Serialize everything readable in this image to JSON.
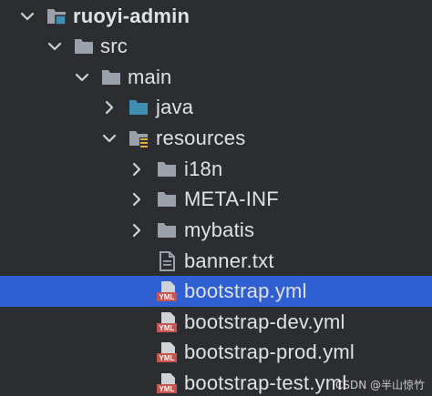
{
  "colors": {
    "background": "#2b2d30",
    "selection": "#2f5fd1",
    "text": "#dfe1e5",
    "folder": "#9aa1ab",
    "source_folder": "#3f8fb3",
    "resources_badge": "#e0b039",
    "yml_badge": "#c75450"
  },
  "tree": {
    "project": {
      "label": "ruoyi-admin",
      "icon": "module-folder-icon",
      "state": "expanded"
    },
    "src": {
      "label": "src",
      "icon": "folder-icon",
      "state": "expanded"
    },
    "main": {
      "label": "main",
      "icon": "folder-icon",
      "state": "expanded"
    },
    "java": {
      "label": "java",
      "icon": "source-folder-icon",
      "state": "collapsed"
    },
    "resources": {
      "label": "resources",
      "icon": "resources-folder-icon",
      "state": "expanded"
    },
    "i18n": {
      "label": "i18n",
      "icon": "folder-icon",
      "state": "collapsed"
    },
    "meta_inf": {
      "label": "META-INF",
      "icon": "folder-icon",
      "state": "collapsed"
    },
    "mybatis": {
      "label": "mybatis",
      "icon": "folder-icon",
      "state": "collapsed"
    },
    "banner": {
      "label": "banner.txt",
      "icon": "text-file-icon"
    },
    "bootstrap": {
      "label": "bootstrap.yml",
      "icon": "yml-file-icon",
      "selected": true
    },
    "bootstrap_dev": {
      "label": "bootstrap-dev.yml",
      "icon": "yml-file-icon"
    },
    "bootstrap_prod": {
      "label": "bootstrap-prod.yml",
      "icon": "yml-file-icon"
    },
    "bootstrap_test": {
      "label": "bootstrap-test.yml",
      "icon": "yml-file-icon"
    }
  },
  "yml_badge_text": "YML",
  "watermark": "CSDN @半山惊竹"
}
